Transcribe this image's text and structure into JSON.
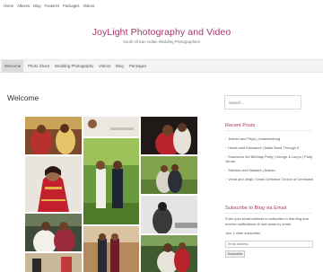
{
  "top_nav": [
    "Home",
    "Albums",
    "Blog",
    "Features",
    "Packages",
    "Videos"
  ],
  "site": {
    "title": "JoyLight Photography and Video",
    "tagline": "South African Indian Wedding Photographers"
  },
  "main_nav": {
    "items": [
      "Welcome",
      "Photo Shoot",
      "Wedding Photography",
      "Videos",
      "Blog",
      "Packages"
    ],
    "active": "Welcome"
  },
  "page": {
    "title": "Welcome"
  },
  "gallery": {
    "photos": [
      "bride-couple-ceremony",
      "couple-portrait-small",
      "couple-in-red",
      "bride-in-red-sari",
      "couple-in-garden",
      "couple-outdoor",
      "groom-and-bride-close",
      "couple-black-white",
      "bride-side-profile",
      "couple-walking-path",
      "couple-on-steps"
    ]
  },
  "sidebar": {
    "search_placeholder": "Search ...",
    "recent_posts_title": "Recent Posts",
    "recent_posts": [
      "Jeshen and Priya | Johannesburg",
      "Hiresh and Kamashni | Make Bona Through It",
      "Shanesha 3rd Birthday Party | George & Lucy's | Party Venue",
      "Shenika and Natasha | Avanto",
      "Vimal and Jesjit | Greek Orthodox Church of Germiston"
    ],
    "subscribe_title": "Subscribe to Blog via Email",
    "subscribe_text": "Enter your email address to subscribe to this blog and receive notifications of new posts by email.",
    "subscribers": "Join 1 other subscriber",
    "email_placeholder": "Email Address",
    "subscribe_button": "Subscribe"
  },
  "colors": {
    "accent": "#a4386a",
    "nav_bg": "#f4f4f4",
    "active_nav_bg": "#dcdcdc"
  }
}
